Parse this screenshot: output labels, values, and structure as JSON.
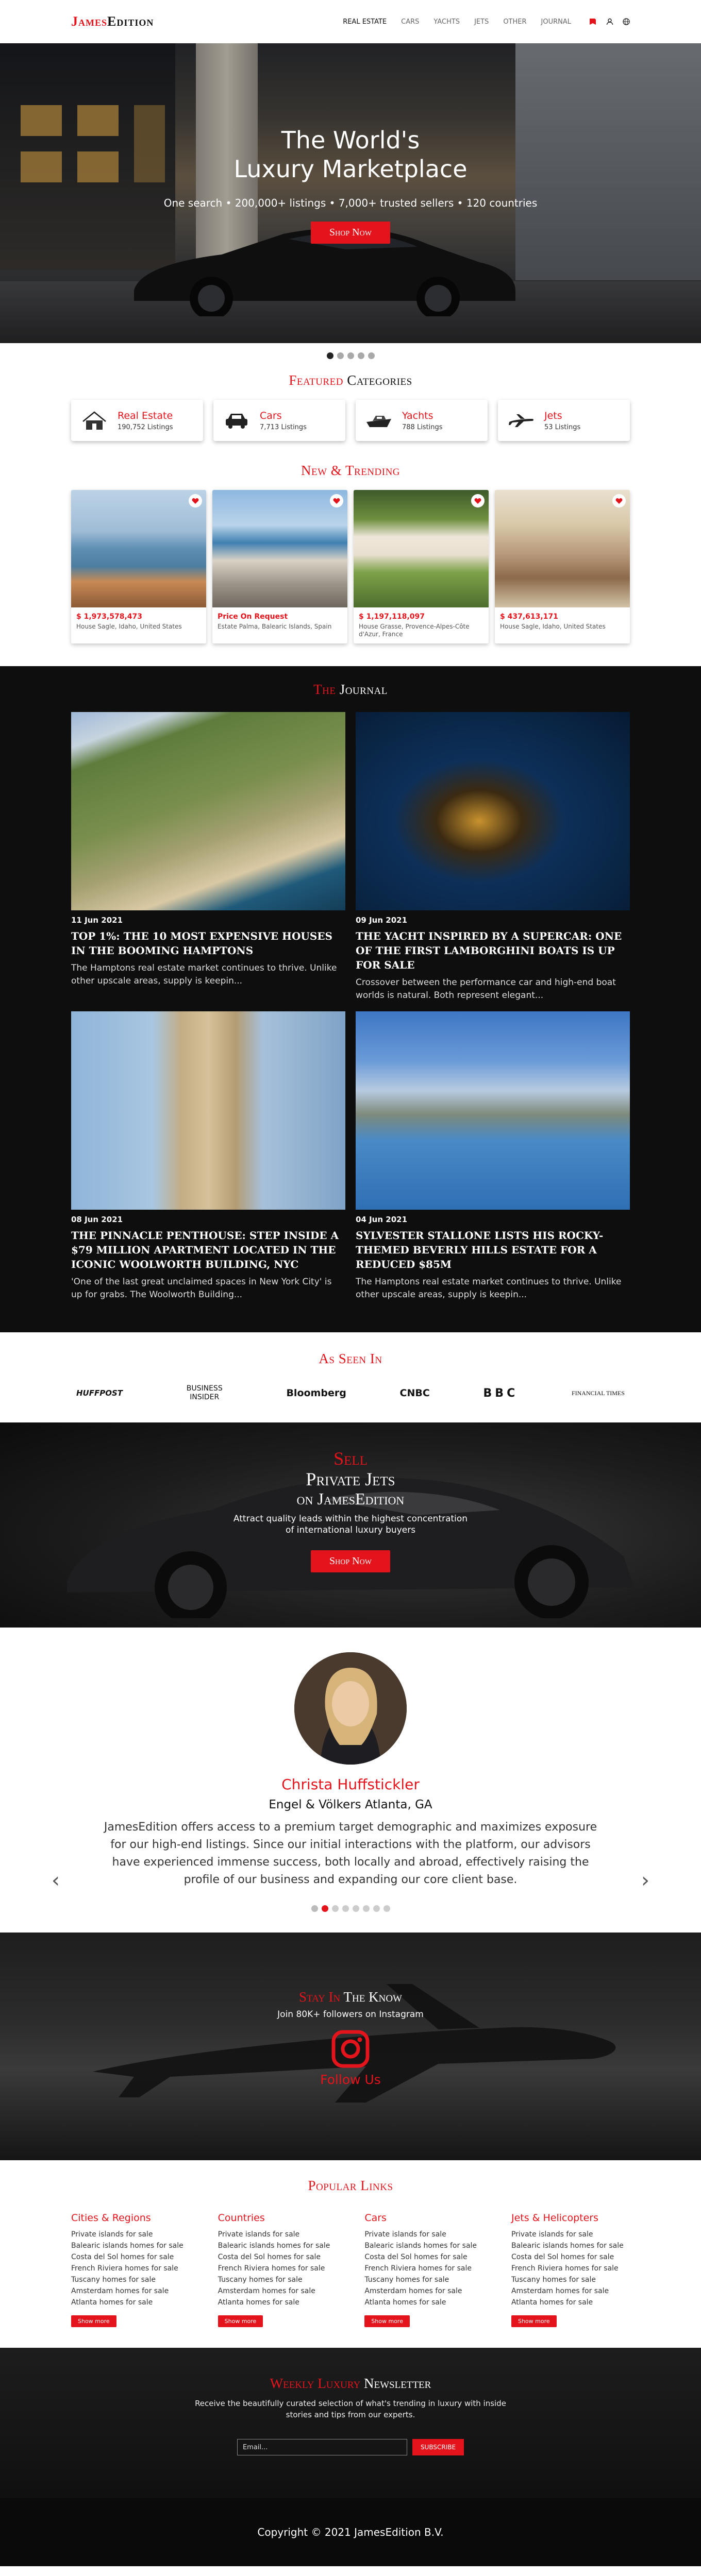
{
  "header": {
    "logo_a": "James",
    "logo_b": "Edition",
    "nav": [
      "REAL ESTATE",
      "CARS",
      "YACHTS",
      "JETS",
      "OTHER",
      "JOURNAL"
    ]
  },
  "hero": {
    "title_line1": "The World's",
    "title_line2": "Luxury Marketplace",
    "subtitle": "One search • 200,000+ listings • 7,000+ trusted sellers • 120 countries",
    "button": "Shop Now"
  },
  "featured": {
    "title_a": "Featured",
    "title_b": "Categories",
    "items": [
      {
        "label": "Real Estate",
        "count": "190,752 Listings",
        "icon": "house-icon"
      },
      {
        "label": "Cars",
        "count": "7,713 Listings",
        "icon": "car-icon"
      },
      {
        "label": "Yachts",
        "count": "788 Listings",
        "icon": "yacht-icon"
      },
      {
        "label": "Jets",
        "count": "53 Listings",
        "icon": "jet-icon"
      }
    ]
  },
  "trending": {
    "title_a": "New &",
    "title_b": "Trending",
    "items": [
      {
        "price": "$ 1,973,578,473",
        "location": "House Sagle, Idaho, United States"
      },
      {
        "price": "Price On Request",
        "location": "Estate Palma, Balearic Islands, Spain"
      },
      {
        "price": "$ 1,197,118,097",
        "location": "House Grasse, Provence-Alpes-Côte d'Azur, France"
      },
      {
        "price": "$ 437,613,171",
        "location": "House Sagle, Idaho, United States"
      }
    ]
  },
  "journal": {
    "title_a": "The",
    "title_b": "Journal",
    "items": [
      {
        "date": "11 Jun 2021",
        "title": "TOP 1%: THE 10 MOST EXPENSIVE HOUSES IN THE BOOMING HAMPTONS",
        "excerpt": "The Hamptons real estate market continues to thrive. Unlike other upscale areas, supply is keepin..."
      },
      {
        "date": "09 Jun 2021",
        "title": "THE YACHT INSPIRED BY A SUPERCAR: ONE OF THE FIRST LAMBORGHINI BOATS IS UP FOR SALE",
        "excerpt": "Crossover between the performance car and high-end boat worlds is natural. Both represent elegant..."
      },
      {
        "date": "08 Jun 2021",
        "title": "THE PINNACLE PENTHOUSE: STEP INSIDE A $79 MILLION APARTMENT LOCATED IN THE ICONIC WOOLWORTH BUILDING, NYC",
        "excerpt": "'One of the last great unclaimed spaces in New York City' is up for grabs. The Woolworth Building..."
      },
      {
        "date": "04 Jun 2021",
        "title": "SYLVESTER STALLONE LISTS HIS ROCKY-THEMED BEVERLY HILLS ESTATE FOR A REDUCED $85M",
        "excerpt": "The Hamptons real estate market continues to thrive. Unlike other upscale areas, supply is keepin..."
      }
    ]
  },
  "seen": {
    "title_a": "As",
    "title_b": "Seen In",
    "logos": [
      "HUFFPOST",
      "BUSINESS INSIDER",
      "Bloomberg",
      "CNBC",
      "BBC",
      "FINANCIAL TIMES"
    ]
  },
  "sell": {
    "line1": "Sell",
    "line2": "Private Jets",
    "line3": "on JamesEdition",
    "desc": "Attract quality leads within the highest concentration of international luxury buyers",
    "button": "Shop Now"
  },
  "testimonial": {
    "name": "Christa Huffstickler",
    "company": "Engel & Völkers Atlanta, GA",
    "quote": "JamesEdition offers access to a premium target demographic and maximizes exposure for our high-end listings. Since our initial interactions with the platform, our advisors have experienced immense success, both locally and abroad, effectively raising the profile of our business and expanding our core client base."
  },
  "instagram": {
    "title_a": "Stay In",
    "title_b": "The Know",
    "subtitle": "Join 80K+ followers on Instagram",
    "follow": "Follow Us"
  },
  "popular": {
    "title_a": "Popular",
    "title_b": "Links",
    "columns": [
      {
        "heading": "Cities & Regions",
        "links": [
          "Private islands for sale",
          "Balearic islands homes for sale",
          "Costa del Sol homes for sale",
          "French Riviera homes for sale",
          "Tuscany homes for sale",
          "Amsterdam homes for sale",
          "Atlanta homes for sale"
        ],
        "button": "Show more"
      },
      {
        "heading": "Countries",
        "links": [
          "Private islands for sale",
          "Balearic islands homes for sale",
          "Costa del Sol homes for sale",
          "French Riviera homes for sale",
          "Tuscany homes for sale",
          "Amsterdam homes for sale",
          "Atlanta homes for sale"
        ],
        "button": "Show more"
      },
      {
        "heading": "Cars",
        "links": [
          "Private islands for sale",
          "Balearic islands homes for sale",
          "Costa del Sol homes for sale",
          "French Riviera homes for sale",
          "Tuscany homes for sale",
          "Amsterdam homes for sale",
          "Atlanta homes for sale"
        ],
        "button": "Show more"
      },
      {
        "heading": "Jets & Helicopters",
        "links": [
          "Private islands for sale",
          "Balearic islands homes for sale",
          "Costa del Sol homes for sale",
          "French Riviera homes for sale",
          "Tuscany homes for sale",
          "Amsterdam homes for sale",
          "Atlanta homes for sale"
        ],
        "button": "Show more"
      }
    ]
  },
  "newsletter": {
    "title_a": "Weekly Luxury",
    "title_b": "Newsletter",
    "desc": "Receive the beautifully curated selection of what's trending in luxury with inside stories and tips from our experts.",
    "placeholder": "Email...",
    "button": "SUBSCRIBE"
  },
  "footer": {
    "copyright": "Copyright © 2021 JamesEdition B.V."
  },
  "colors": {
    "accent": "#e4141c",
    "dark": "#0e0e0e"
  }
}
